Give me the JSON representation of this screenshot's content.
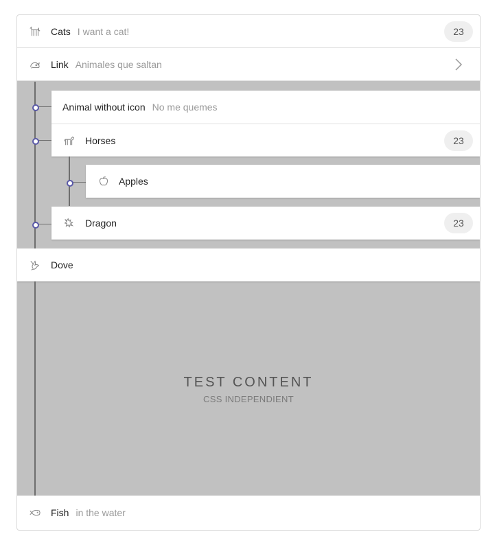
{
  "items": {
    "cats": {
      "title": "Cats",
      "subtitle": "I want a cat!",
      "badge": "23",
      "icon": "cat-icon"
    },
    "link": {
      "title": "Link",
      "subtitle": "Animales que saltan",
      "icon": "rabbit-icon",
      "trailing": "chevron-right-icon"
    },
    "animal_without_icon": {
      "title": "Animal without icon",
      "subtitle": "No me quemes"
    },
    "horses": {
      "title": "Horses",
      "badge": "23",
      "icon": "horse-icon"
    },
    "apples": {
      "title": "Apples",
      "icon": "apple-icon"
    },
    "dragon": {
      "title": "Dragon",
      "badge": "23",
      "icon": "dragon-icon"
    },
    "dove": {
      "title": "Dove",
      "icon": "dove-icon"
    },
    "fish": {
      "title": "Fish",
      "subtitle": "in the water",
      "icon": "fish-icon"
    }
  },
  "test_content": {
    "title": "TEST CONTENT",
    "subtitle": "CSS INDEPENDIENT"
  },
  "colors": {
    "tree_dot": "#5a59a8",
    "nested_bg": "#c1c1c1"
  }
}
